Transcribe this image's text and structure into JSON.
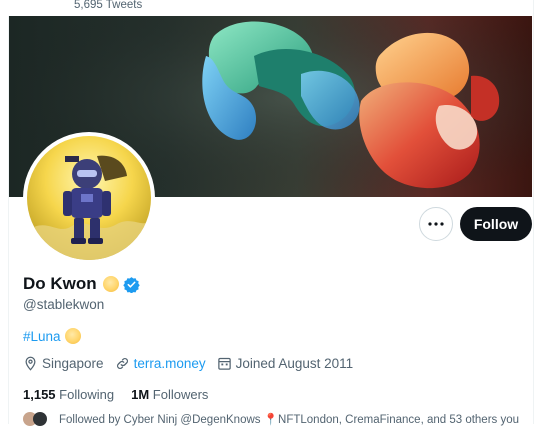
{
  "header": {
    "tweets_count": "5,695 Tweets"
  },
  "profile": {
    "display_name": "Do Kwon",
    "handle": "@stablekwon",
    "bio_hashtag": "#Luna",
    "location": "Singapore",
    "website": "terra.money",
    "joined": "Joined August 2011",
    "following_count": "1,155",
    "following_label": "Following",
    "followers_count": "1M",
    "followers_label": "Followers",
    "followed_by": "Followed by Cyber Ninj @DegenKnows 📍NFTLondon, CremaFinance, and 53 others you"
  },
  "actions": {
    "follow_label": "Follow",
    "more_icon": "more-horizontal-icon"
  },
  "icons": {
    "location": "map-pin-icon",
    "link": "link-icon",
    "calendar": "calendar-icon",
    "verified": "verified-badge-icon",
    "emoji": "moon-emoji"
  },
  "colors": {
    "accent": "#1d9bf0",
    "text": "#0f1419",
    "muted": "#536471",
    "follow_bg": "#0f1419"
  }
}
